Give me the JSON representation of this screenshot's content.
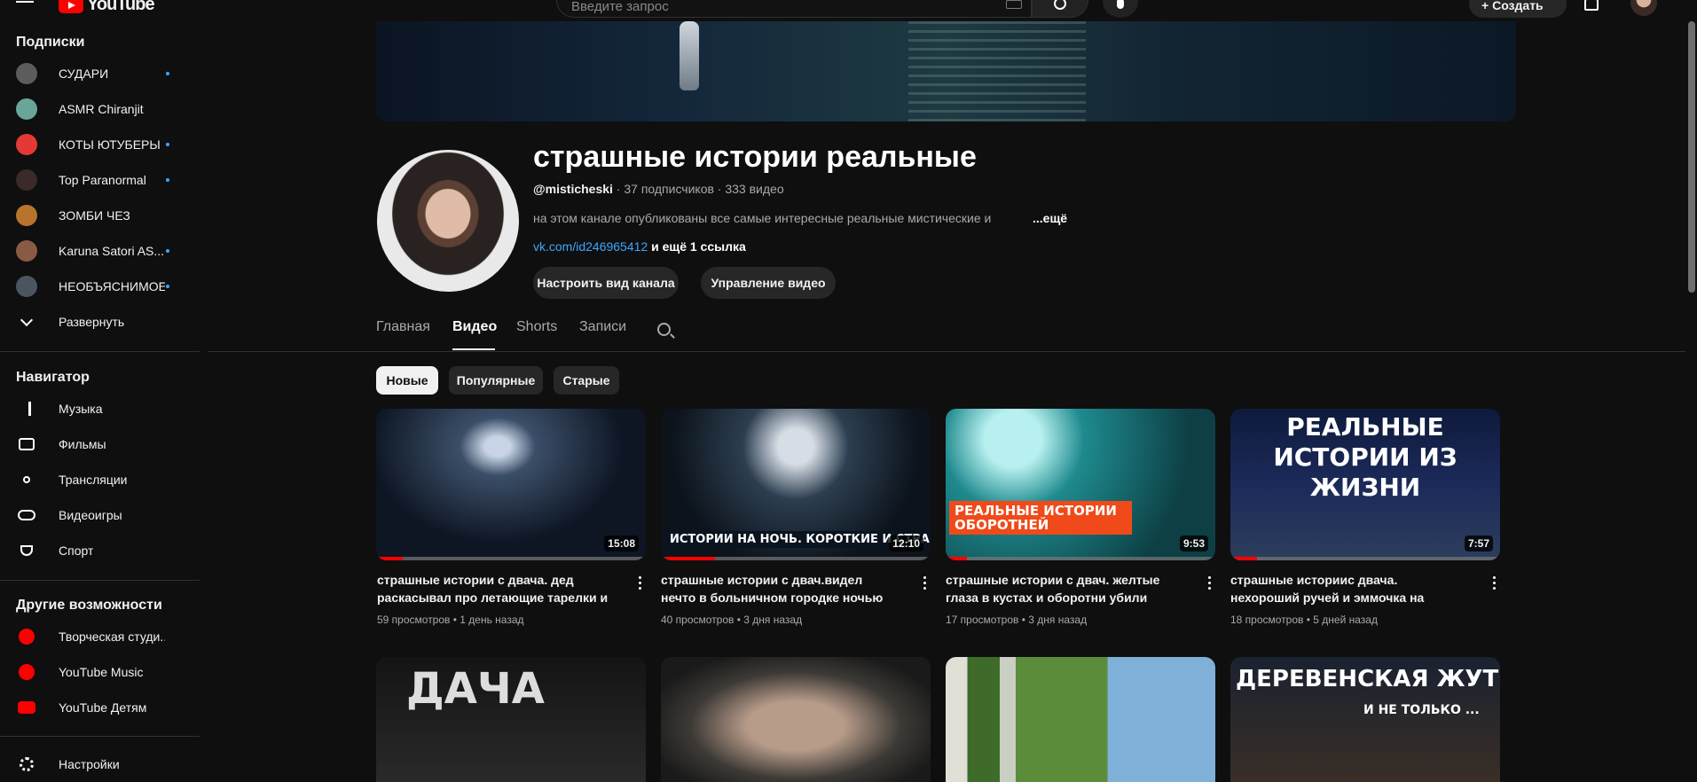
{
  "header": {
    "logo": "YouTube",
    "search_placeholder": "Введите запрос",
    "create_label": "Создать"
  },
  "sidebar": {
    "subscriptions_title": "Подписки",
    "subscriptions": [
      {
        "label": "СУДАРИ",
        "new": true,
        "color": "#5c5c5c"
      },
      {
        "label": "ASMR Chiranjit",
        "new": false,
        "color": "#6aa59a"
      },
      {
        "label": "КОТЫ ЮТУБЕРЫ",
        "new": true,
        "color": "#e53935"
      },
      {
        "label": "Top Paranormal",
        "new": true,
        "color": "#3b2a2a"
      },
      {
        "label": "ЗОМБИ ЧЕЗ",
        "new": false,
        "color": "#b8742c"
      },
      {
        "label": "Karuna Satori AS...",
        "new": true,
        "color": "#8a5a44"
      },
      {
        "label": "НЕОБЪЯСНИМОЕ",
        "new": true,
        "color": "#4a5560"
      }
    ],
    "expand_label": "Развернуть",
    "navigator_title": "Навигатор",
    "navigator": [
      {
        "label": "Музыка",
        "icon": "music-note-icon"
      },
      {
        "label": "Фильмы",
        "icon": "film-icon"
      },
      {
        "label": "Трансляции",
        "icon": "live-icon"
      },
      {
        "label": "Видеоигры",
        "icon": "gamepad-icon"
      },
      {
        "label": "Спорт",
        "icon": "trophy-icon"
      }
    ],
    "other_title": "Другие возможности",
    "other": [
      {
        "label": "Творческая студи...",
        "icon": "studio-icon"
      },
      {
        "label": "YouTube Music",
        "icon": "youtube-music-icon"
      },
      {
        "label": "YouTube Детям",
        "icon": "youtube-kids-icon"
      }
    ],
    "settings_label": "Настройки"
  },
  "channel": {
    "title": "страшные истории реальные",
    "handle": "@misticheski",
    "stats": " · 37 подписчиков · 333 видео",
    "description": "на этом канале опубликованы все самые интересные реальные мистические и",
    "more": "...ещё",
    "link": "vk.com/id246965412",
    "link_more": " и ещё 1 ссылка",
    "customize_button": "Настроить вид канала",
    "manage_button": "Управление видео"
  },
  "tabs": [
    "Главная",
    "Видео",
    "Shorts",
    "Записи"
  ],
  "active_tab": "Видео",
  "chips": [
    "Новые",
    "Популярные",
    "Старые"
  ],
  "videos": [
    {
      "title": "страшные истории с двача. дед раскасывал про летающие тарелки и чт...",
      "views": "59 просмотров",
      "age": "1 день назад",
      "duration": "15:08",
      "progress": 0.1
    },
    {
      "title": "страшные истории с двач.видел нечто в больничном городке ночью",
      "views": "40 просмотров",
      "age": "3 дня назад",
      "duration": "12:10",
      "progress": 0.2,
      "overlay": "ИСТОРИИ НА НОЧЬ. КОРОТКИЕ И СТРАШ..."
    },
    {
      "title": "страшные истории с двач. желтые глаза в кустах и оборотни убили",
      "views": "17 просмотров",
      "age": "3 дня назад",
      "duration": "9:53",
      "progress": 0.08,
      "overlay": "РЕАЛЬНЫЕ ИСТОРИИ ОБОРОТНЕЙ"
    },
    {
      "title": "страшные историис двача. нехороший ручей и эммочка на чердаке",
      "views": "18 просмотров",
      "age": "5 дней назад",
      "duration": "7:57",
      "progress": 0.1,
      "overlay": "РЕАЛЬНЫЕ ИСТОРИИ ИЗ ЖИЗНИ"
    }
  ],
  "row2_overlays": [
    "ДАЧА",
    "",
    "",
    "ДЕРЕВЕНСКАЯ ЖУТЬ",
    "И НЕ ТОЛЬКО ..."
  ]
}
